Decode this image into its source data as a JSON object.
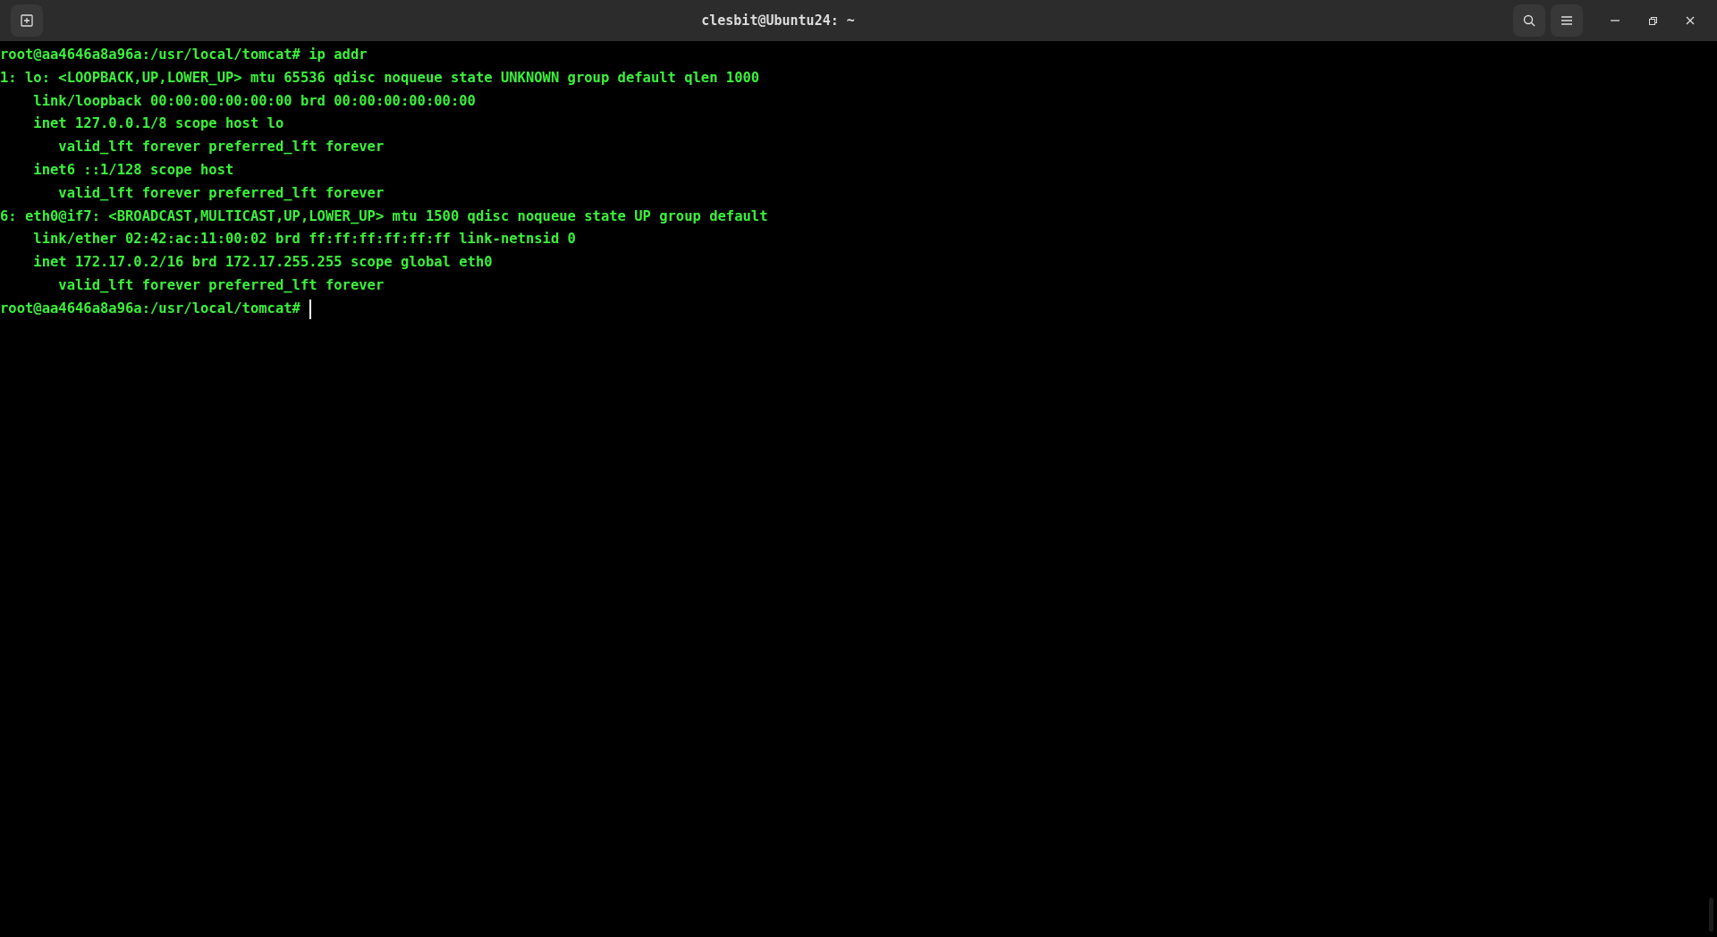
{
  "window": {
    "title": "clesbit@Ubuntu24: ~"
  },
  "terminal": {
    "lines": [
      "root@aa4646a8a96a:/usr/local/tomcat# ip addr",
      "1: lo: <LOOPBACK,UP,LOWER_UP> mtu 65536 qdisc noqueue state UNKNOWN group default qlen 1000",
      "    link/loopback 00:00:00:00:00:00 brd 00:00:00:00:00:00",
      "    inet 127.0.0.1/8 scope host lo",
      "       valid_lft forever preferred_lft forever",
      "    inet6 ::1/128 scope host",
      "       valid_lft forever preferred_lft forever",
      "6: eth0@if7: <BROADCAST,MULTICAST,UP,LOWER_UP> mtu 1500 qdisc noqueue state UP group default",
      "    link/ether 02:42:ac:11:00:02 brd ff:ff:ff:ff:ff:ff link-netnsid 0",
      "    inet 172.17.0.2/16 brd 172.17.255.255 scope global eth0",
      "       valid_lft forever preferred_lft forever"
    ],
    "prompt": "root@aa4646a8a96a:/usr/local/tomcat#"
  }
}
